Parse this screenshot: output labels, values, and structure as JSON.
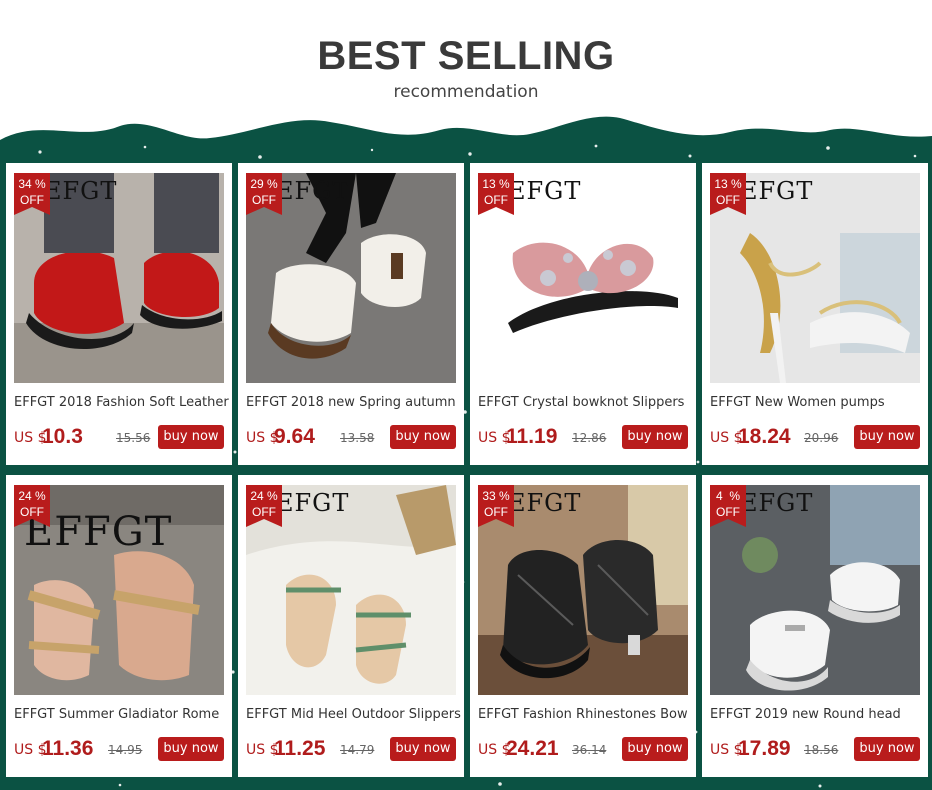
{
  "header": {
    "title": "BEST SELLING",
    "subtitle": "recommendation"
  },
  "colors": {
    "band": "#0b5243",
    "accent": "#b91c1c",
    "price": "#b01c1c"
  },
  "products": [
    {
      "brand": "EFGT",
      "discount": "34 %",
      "off": "OFF",
      "name": "EFFGT 2018 Fashion Soft Leather",
      "currency": "US $",
      "price": "10.3",
      "old_price": "15.56",
      "button": "buy now"
    },
    {
      "brand": "EFGT",
      "discount": "29 %",
      "off": "OFF",
      "name": "EFFGT 2018 new Spring autumn",
      "currency": "US $",
      "price": "9.64",
      "old_price": "13.58",
      "button": "buy now"
    },
    {
      "brand": "EFGT",
      "discount": "13 %",
      "off": "OFF",
      "name": "EFFGT Crystal bowknot Slippers",
      "currency": "US $",
      "price": "11.19",
      "old_price": "12.86",
      "button": "buy now"
    },
    {
      "brand": "EFGT",
      "discount": "13 %",
      "off": "OFF",
      "name": "EFFGT New Women pumps",
      "currency": "US $",
      "price": "18.24",
      "old_price": "20.96",
      "button": "buy now"
    },
    {
      "brand": "EFFGT",
      "discount": "24 %",
      "off": "OFF",
      "name": "EFFGT Summer Gladiator Rome",
      "currency": "US $",
      "price": "11.36",
      "old_price": "14.95",
      "button": "buy now"
    },
    {
      "brand": "EFGT",
      "discount": "24 %",
      "off": "OFF",
      "name": "EFFGT Mid Heel Outdoor Slippers",
      "currency": "US $",
      "price": "11.25",
      "old_price": "14.79",
      "button": "buy now"
    },
    {
      "brand": "EFGT",
      "discount": "33 %",
      "off": "OFF",
      "name": "EFFGT Fashion Rhinestones Bow",
      "currency": "US $",
      "price": "24.21",
      "old_price": "36.14",
      "button": "buy now"
    },
    {
      "brand": "EFGT",
      "discount": "4  %",
      "off": "OFF",
      "name": "EFFGT 2019 new Round head",
      "currency": "US $",
      "price": "17.89",
      "old_price": "18.56",
      "button": "buy now"
    }
  ]
}
